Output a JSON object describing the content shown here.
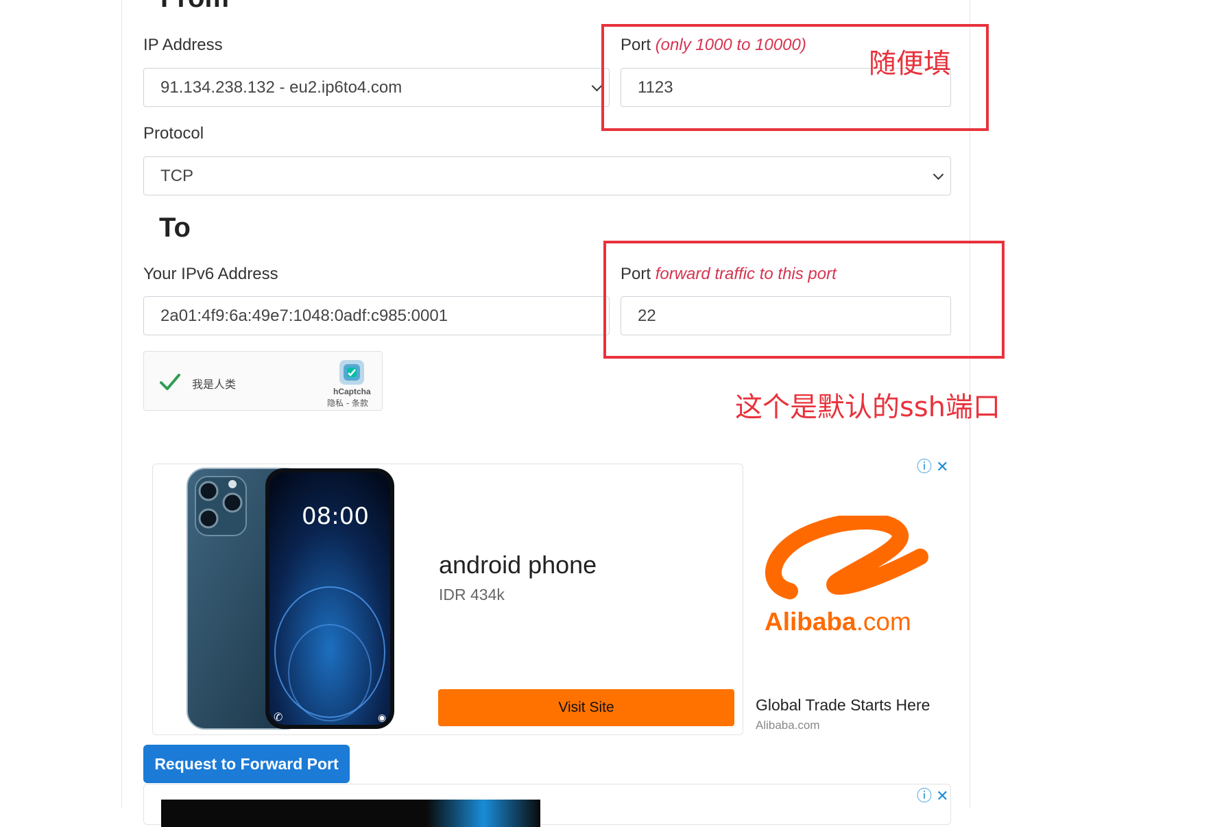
{
  "from": {
    "heading": "From",
    "ip_label": "IP Address",
    "ip_value": "91.134.238.132 - eu2.ip6to4.com",
    "port_label": "Port",
    "port_hint": "(only 1000 to 10000)",
    "port_value": "1123",
    "protocol_label": "Protocol",
    "protocol_value": "TCP"
  },
  "to": {
    "heading": "To",
    "ipv6_label": "Your IPv6 Address",
    "ipv6_value": "2a01:4f9:6a:49e7:1048:0adf:c985:0001",
    "port_label": "Port",
    "port_hint": "forward traffic to this port",
    "port_value": "22"
  },
  "annotations": {
    "note_port_any": "随便填",
    "note_default_ssh": "这个是默认的ssh端口",
    "color": "#e8323c"
  },
  "captcha": {
    "label": "我是人类",
    "brand": "hCaptcha",
    "links": "隐私 - 条款"
  },
  "ad1": {
    "phone_time": "08:00",
    "title": "android phone",
    "price": "IDR 434k",
    "cta": "Visit Site",
    "logo_text": "Alibaba",
    "logo_suffix": ".com",
    "tagline": "Global Trade Starts Here",
    "domain": "Alibaba.com",
    "info_icon": "ⓘ",
    "close_icon": "✕"
  },
  "submit": {
    "label": "Request to Forward Port"
  },
  "ad2": {
    "info_icon": "ⓘ",
    "close_icon": "✕"
  },
  "colors": {
    "accent_blue": "#1b7bd6",
    "cta_orange": "#ff7200",
    "hint_red": "#d6334f"
  }
}
